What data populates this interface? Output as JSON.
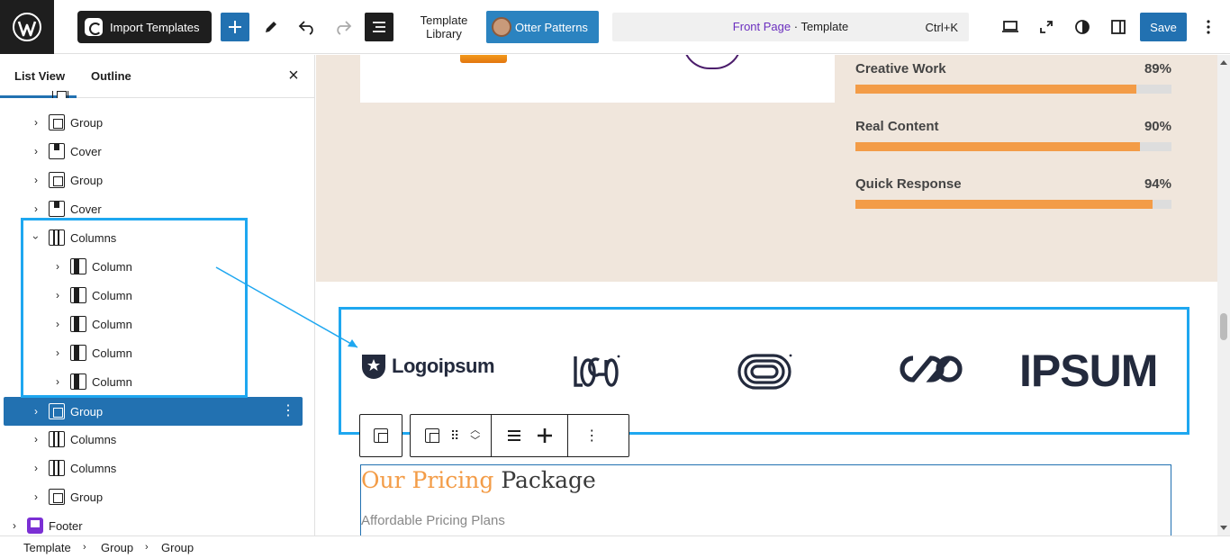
{
  "topbar": {
    "import_label": "Import Templates",
    "template_library_line1": "Template",
    "template_library_line2": "Library",
    "otter_label": "Otter Patterns",
    "doc_page": "Front Page",
    "doc_sep": " · ",
    "doc_type": "Template",
    "shortcut": "Ctrl+K",
    "save_label": "Save",
    "accent": "#2271b1"
  },
  "sidebar": {
    "tabs": [
      "List View",
      "Outline"
    ],
    "active_tab": "List View",
    "items": [
      {
        "label": "Group",
        "icon": "group-icon",
        "depth": 1
      },
      {
        "label": "Cover",
        "icon": "cover-icon",
        "depth": 1
      },
      {
        "label": "Group",
        "icon": "group-icon",
        "depth": 1
      },
      {
        "label": "Cover",
        "icon": "cover-icon",
        "depth": 1
      },
      {
        "label": "Columns",
        "icon": "columns-icon",
        "depth": 1,
        "expanded": true
      },
      {
        "label": "Column",
        "icon": "column-icon",
        "depth": 2
      },
      {
        "label": "Column",
        "icon": "column-icon",
        "depth": 2
      },
      {
        "label": "Column",
        "icon": "column-icon",
        "depth": 2
      },
      {
        "label": "Column",
        "icon": "column-icon",
        "depth": 2
      },
      {
        "label": "Column",
        "icon": "column-icon",
        "depth": 2
      },
      {
        "label": "Group",
        "icon": "group-icon",
        "depth": 1,
        "selected": true
      },
      {
        "label": "Columns",
        "icon": "columns-icon",
        "depth": 1
      },
      {
        "label": "Columns",
        "icon": "columns-icon",
        "depth": 1
      },
      {
        "label": "Group",
        "icon": "group-icon",
        "depth": 1
      },
      {
        "label": "Footer",
        "icon": "footer-icon",
        "depth": 0
      }
    ]
  },
  "canvas": {
    "skills": [
      {
        "name": "Creative Work",
        "percent": "89%",
        "value": 0.89
      },
      {
        "name": "Real Content",
        "percent": "90%",
        "value": 0.9
      },
      {
        "name": "Quick Response",
        "percent": "94%",
        "value": 0.94
      }
    ],
    "logos": [
      "Logoipsum",
      "IPSUM"
    ],
    "pricing_title_accent": "Our Pricing",
    "pricing_title_rest": " Package",
    "pricing_subtitle": "Affordable Pricing Plans",
    "accent_orange": "#f39c47",
    "highlight_color": "#1ea7f0"
  },
  "breadcrumb": [
    "Template",
    "Group",
    "Group"
  ]
}
